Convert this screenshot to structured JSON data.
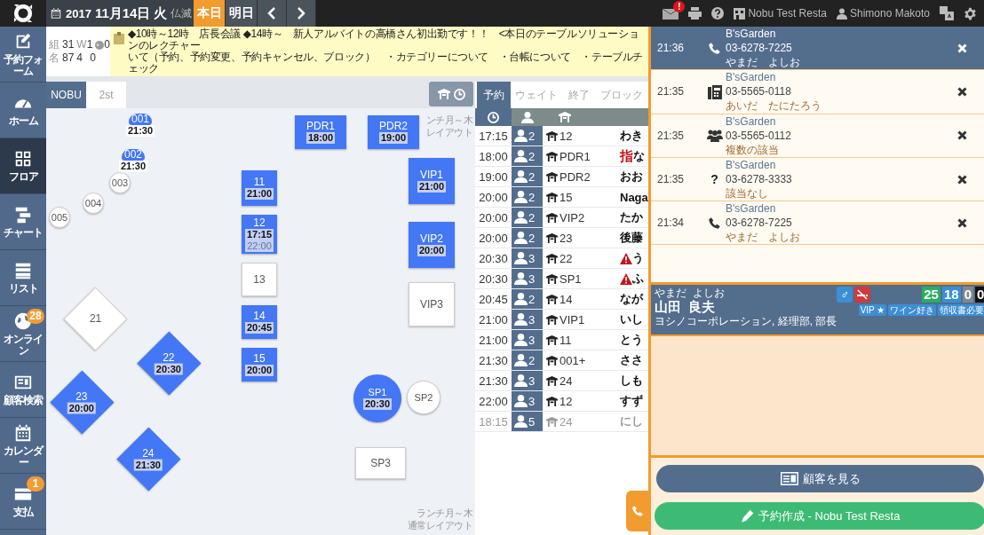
{
  "topbar": {
    "year": "2017",
    "date": "11月14日",
    "weekday": "火",
    "rokuyo": "仏滅",
    "day_buttons": [
      {
        "label": "本日",
        "selected": true
      },
      {
        "label": "明日",
        "selected": false
      }
    ],
    "mail_badge": "!",
    "store": "Nobu Test Resta",
    "user": "Shimono Makoto"
  },
  "sidebar": [
    {
      "label": "予約フォーム",
      "kind": "form",
      "selected": false
    },
    {
      "label": "ホーム",
      "kind": "gauge",
      "selected": false
    },
    {
      "label": "フロア",
      "kind": "grid",
      "selected": true
    },
    {
      "label": "チャート",
      "kind": "chart",
      "selected": false
    },
    {
      "label": "リスト",
      "kind": "list",
      "selected": false
    },
    {
      "label": "オンライン",
      "kind": "globe",
      "selected": false,
      "badge": "28"
    },
    {
      "label": "顧客検索",
      "kind": "idcard",
      "selected": false
    },
    {
      "label": "カレンダー",
      "kind": "calendar",
      "selected": false
    },
    {
      "label": "支払",
      "kind": "payment",
      "selected": false,
      "badge": "1"
    }
  ],
  "counts": [
    {
      "label": "組",
      "values": [
        {
          "value": "31"
        },
        {
          "prefix": "W",
          "value": "1"
        },
        {
          "icon": true,
          "value": "0"
        }
      ]
    },
    {
      "label": "名",
      "values": [
        {
          "value": "87"
        },
        {
          "value": "4"
        },
        {
          "value": "0"
        }
      ]
    }
  ],
  "notice": [
    "◆10時～12時　店長会議 ◆14時～　新人アルバイトの高橋さん初出勤です！！　<本日のテーブルソリューションのレクチャー",
    "いて（予約、予約変更、予約キャンセル、ブロック）　・カテゴリーについて　・台帳について　・テーブルチェック"
  ],
  "floor": {
    "tabs": [
      {
        "label": "NOBU",
        "selected": true
      },
      {
        "label": "2st",
        "selected": false
      }
    ],
    "layout_label_top": [
      "ンチ月～木",
      "レイアウト"
    ],
    "layout_label_bottom": [
      "ランチ月～木",
      "通常レイアウト"
    ],
    "tables": [
      {
        "label": "001",
        "kind": "dot",
        "reserved": true,
        "times": [
          {
            "time": "21:30",
            "faded": false
          }
        ]
      },
      {
        "label": "002",
        "kind": "dot",
        "reserved": true,
        "times": [
          {
            "time": "21:30",
            "faded": false
          }
        ]
      },
      {
        "label": "003",
        "kind": "circle",
        "reserved": false
      },
      {
        "label": "004",
        "kind": "circle",
        "reserved": false
      },
      {
        "label": "005",
        "kind": "circle",
        "reserved": false
      },
      {
        "label": "PDR1",
        "kind": "square",
        "reserved": true,
        "times": [
          {
            "time": "18:00",
            "faded": false
          }
        ]
      },
      {
        "label": "PDR2",
        "kind": "square",
        "reserved": true,
        "times": [
          {
            "time": "19:00",
            "faded": false
          }
        ]
      },
      {
        "label": "VIP1",
        "kind": "square",
        "reserved": true,
        "times": [
          {
            "time": "21:00",
            "faded": false
          }
        ]
      },
      {
        "label": "VIP2",
        "kind": "square",
        "reserved": true,
        "times": [
          {
            "time": "20:00",
            "faded": false
          }
        ]
      },
      {
        "label": "VIP3",
        "kind": "square",
        "reserved": false
      },
      {
        "label": "11",
        "kind": "square",
        "reserved": true,
        "times": [
          {
            "time": "21:00",
            "faded": false
          }
        ]
      },
      {
        "label": "12",
        "kind": "square",
        "reserved": true,
        "times": [
          {
            "time": "17:15",
            "faded": false
          },
          {
            "time": "22:00",
            "faded": true
          }
        ]
      },
      {
        "label": "13",
        "kind": "square",
        "reserved": false
      },
      {
        "label": "14",
        "kind": "square",
        "reserved": true,
        "times": [
          {
            "time": "20:45",
            "faded": false
          }
        ]
      },
      {
        "label": "15",
        "kind": "square",
        "reserved": true,
        "times": [
          {
            "time": "20:00",
            "faded": false
          }
        ]
      },
      {
        "label": "21",
        "kind": "diamond",
        "reserved": false
      },
      {
        "label": "22",
        "kind": "diamond",
        "reserved": true,
        "times": [
          {
            "time": "20:30",
            "faded": false
          }
        ]
      },
      {
        "label": "23",
        "kind": "diamond",
        "reserved": true,
        "times": [
          {
            "time": "20:00",
            "faded": false
          }
        ]
      },
      {
        "label": "24",
        "kind": "diamond",
        "reserved": true,
        "times": [
          {
            "time": "21:30",
            "faded": false
          }
        ]
      },
      {
        "label": "SP1",
        "kind": "circle",
        "reserved": true,
        "times": [
          {
            "time": "20:30",
            "faded": false
          }
        ]
      },
      {
        "label": "SP2",
        "kind": "circle",
        "reserved": false
      },
      {
        "label": "SP3",
        "kind": "square",
        "reserved": false
      }
    ]
  },
  "reservations": {
    "tabs": [
      {
        "label": "予約",
        "selected": true
      },
      {
        "label": "ウェイト",
        "selected": false
      },
      {
        "label": "終了",
        "selected": false
      },
      {
        "label": "ブロック",
        "selected": false
      }
    ],
    "rows": [
      {
        "time": "17:15",
        "guests": "2",
        "table": "12",
        "name": "わき",
        "warning": false,
        "past": false
      },
      {
        "time": "18:00",
        "guests": "2",
        "table": "PDR1",
        "tag": "指",
        "name": "な",
        "warning": false,
        "past": false
      },
      {
        "time": "19:00",
        "guests": "2",
        "table": "PDR2",
        "name": "おお",
        "warning": false,
        "past": false
      },
      {
        "time": "20:00",
        "guests": "2",
        "table": "15",
        "name": "Naga",
        "warning": false,
        "past": false
      },
      {
        "time": "20:00",
        "guests": "2",
        "table": "VIP2",
        "name": "たか",
        "warning": false,
        "past": false
      },
      {
        "time": "20:00",
        "guests": "2",
        "table": "23",
        "name": "後藤",
        "warning": false,
        "past": false
      },
      {
        "time": "20:30",
        "guests": "3",
        "table": "22",
        "name": "う",
        "warning": true,
        "past": false
      },
      {
        "time": "20:30",
        "guests": "3",
        "table": "SP1",
        "name": "ふ",
        "warning": true,
        "past": false
      },
      {
        "time": "20:45",
        "guests": "2",
        "table": "14",
        "name": "なが",
        "warning": false,
        "past": false
      },
      {
        "time": "21:00",
        "guests": "3",
        "table": "VIP1",
        "name": "いし",
        "warning": false,
        "past": false
      },
      {
        "time": "21:00",
        "guests": "3",
        "table": "11",
        "name": "とう",
        "warning": false,
        "past": false
      },
      {
        "time": "21:30",
        "guests": "2",
        "table": "001+",
        "name": "ささ",
        "warning": false,
        "past": false
      },
      {
        "time": "21:30",
        "guests": "3",
        "table": "24",
        "name": "しも",
        "warning": false,
        "past": false
      },
      {
        "time": "22:00",
        "guests": "3",
        "table": "12",
        "name": "すず",
        "warning": false,
        "past": false
      },
      {
        "time": "18:15",
        "guests": "5",
        "table": "24",
        "name": "にし",
        "warning": false,
        "past": true
      }
    ]
  },
  "calls": [
    {
      "time": "21:36",
      "kind": "phone",
      "company": "B'sGarden",
      "phone": "03-6278-7225",
      "name": "やまだ　よしお",
      "selected": true
    },
    {
      "time": "21:35",
      "kind": "fax",
      "company": "B'sGarden",
      "phone": "03-5565-0118",
      "name": "あいだ　たにたろう",
      "selected": false
    },
    {
      "time": "21:35",
      "kind": "group",
      "company": "B'sGarden",
      "phone": "03-5565-0112",
      "name": "複数の該当",
      "selected": false
    },
    {
      "time": "21:35",
      "kind": "unknown",
      "symbol": "?",
      "company": "B'sGarden",
      "phone": "03-6278-3333",
      "name": "該当なし",
      "selected": false
    },
    {
      "time": "21:34",
      "kind": "phone",
      "company": "B'sGarden",
      "phone": "03-6278-7225",
      "name": "やまだ　よしお",
      "selected": false
    }
  ],
  "customer": {
    "kana": "やまだ  よしお",
    "name": "山田  良夫",
    "company": "ヨシノコーポレーション, 経理部, 部長",
    "gender": "♂",
    "non_smoking": true,
    "counters": [
      {
        "value": "25",
        "color": "#27ae60"
      },
      {
        "value": "18",
        "color": "#3b8fd6"
      },
      {
        "value": "0",
        "color": "#7f8a8c"
      },
      {
        "value": "0",
        "color": "#111111"
      }
    ],
    "tags": [
      "VIP ★",
      "ワイン好き",
      "領収書必要"
    ]
  },
  "actions": [
    {
      "label": "顧客を見る",
      "kind": "customer"
    },
    {
      "label": "予約作成 - Nobu Test Resta",
      "kind": "create"
    }
  ]
}
